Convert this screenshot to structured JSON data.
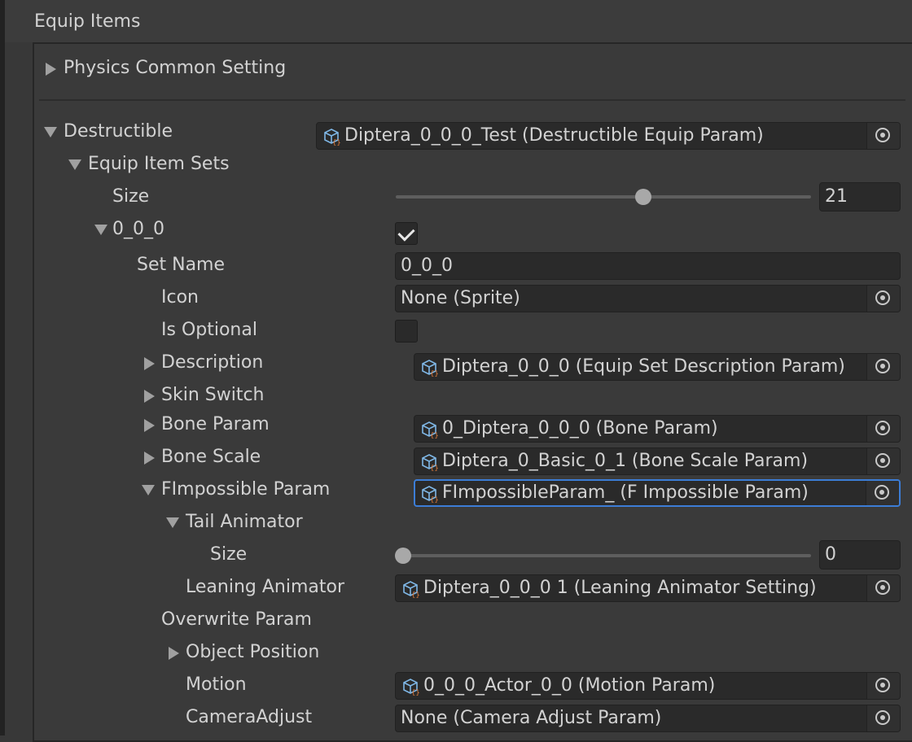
{
  "header": {
    "title": "Equip Items"
  },
  "rows": {
    "physics_common_setting": "Physics Common Setting",
    "destructible": "Destructible",
    "destructible_value": "Diptera_0_0_0_Test (Destructible Equip Param)",
    "equip_item_sets": "Equip Item Sets",
    "size_label": "Size",
    "size_value": "21",
    "size_slider_fraction": 0.6,
    "set_000": "0_0_0",
    "set_000_checked": true,
    "set_name_label": "Set Name",
    "set_name_value": "0_0_0",
    "icon_label": "Icon",
    "icon_value": "None (Sprite)",
    "is_optional_label": "Is Optional",
    "is_optional_checked": false,
    "description_label": "Description",
    "description_value": "Diptera_0_0_0 (Equip Set Description Param)",
    "skin_switch_label": "Skin Switch",
    "bone_param_label": "Bone Param",
    "bone_param_value": "0_Diptera_0_0_0 (Bone Param)",
    "bone_scale_label": "Bone Scale",
    "bone_scale_value": "Diptera_0_Basic_0_1 (Bone Scale Param)",
    "fimpossible_label": "FImpossible Param",
    "fimpossible_value": "FImpossibleParam_ (F Impossible Param)",
    "tail_animator_label": "Tail Animator",
    "tail_size_label": "Size",
    "tail_size_value": "0",
    "tail_size_slider_fraction": 0.0,
    "leaning_label": "Leaning Animator",
    "leaning_value": "Diptera_0_0_0 1 (Leaning Animator Setting)",
    "overwrite_label": "Overwrite Param",
    "object_position_label": "Object Position",
    "motion_label": "Motion",
    "motion_value": "0_0_0_Actor_0_0 (Motion Param)",
    "camera_adjust_label": "CameraAdjust",
    "camera_adjust_value": "None (Camera Adjust Param)"
  },
  "colors": {
    "background": "#383838",
    "field": "#2a2a2a",
    "focus_border": "#3c7dd6",
    "text": "#d2d2d2"
  },
  "icons": {
    "object_field": "scriptable-object-icon",
    "picker": "object-picker-icon",
    "foldout_collapsed": "triangle-right-icon",
    "foldout_expanded": "triangle-down-icon"
  }
}
